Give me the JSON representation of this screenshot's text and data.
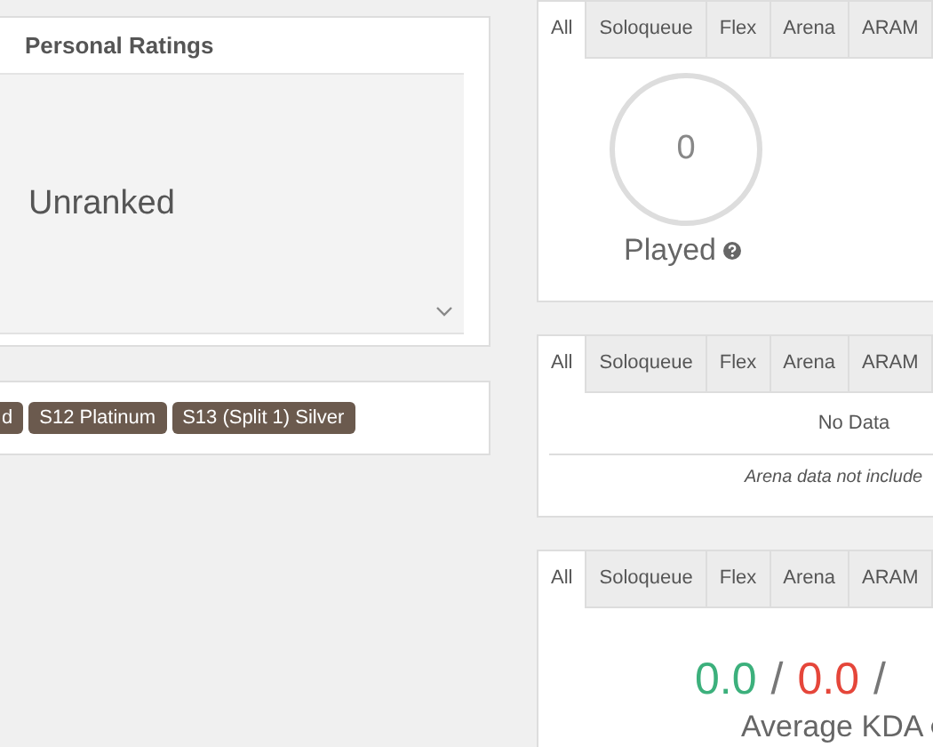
{
  "personal_ratings": {
    "title": "Personal Ratings",
    "rank": "Unranked"
  },
  "season_badges": [
    "d",
    "S12 Platinum",
    "S13 (Split 1) Silver"
  ],
  "panels": [
    {
      "tabs": [
        {
          "label": "All",
          "selected": true
        },
        {
          "label": "Soloqueue",
          "selected": false
        },
        {
          "label": "Flex",
          "selected": false
        },
        {
          "label": "Arena",
          "selected": false
        },
        {
          "label": "ARAM",
          "selected": false
        }
      ],
      "kind": "played",
      "value": "0",
      "caption": "Played"
    },
    {
      "tabs": [
        {
          "label": "All",
          "selected": true
        },
        {
          "label": "Soloqueue",
          "selected": false
        },
        {
          "label": "Flex",
          "selected": false
        },
        {
          "label": "Arena",
          "selected": false
        },
        {
          "label": "ARAM",
          "selected": false
        }
      ],
      "kind": "nodata",
      "message": "No Data",
      "note": "Arena data not include"
    },
    {
      "tabs": [
        {
          "label": "All",
          "selected": true
        },
        {
          "label": "Soloqueue",
          "selected": false
        },
        {
          "label": "Flex",
          "selected": false
        },
        {
          "label": "Arena",
          "selected": false
        },
        {
          "label": "ARAM",
          "selected": false
        }
      ],
      "kind": "kda",
      "parts": [
        {
          "text": "0.0",
          "color": "#3cb07c"
        },
        {
          "text": "/"
        },
        {
          "text": "0.0",
          "color": "#e5463a"
        },
        {
          "text": "/"
        }
      ],
      "caption": "Average KDA"
    }
  ]
}
